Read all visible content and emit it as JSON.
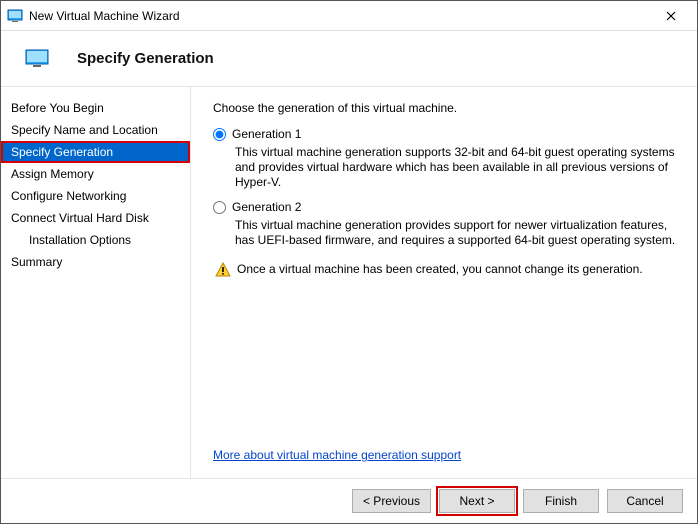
{
  "titlebar": {
    "title": "New Virtual Machine Wizard"
  },
  "header": {
    "heading": "Specify Generation"
  },
  "sidebar": {
    "items": [
      {
        "label": "Before You Begin",
        "selected": false,
        "indent": false
      },
      {
        "label": "Specify Name and Location",
        "selected": false,
        "indent": false
      },
      {
        "label": "Specify Generation",
        "selected": true,
        "indent": false
      },
      {
        "label": "Assign Memory",
        "selected": false,
        "indent": false
      },
      {
        "label": "Configure Networking",
        "selected": false,
        "indent": false
      },
      {
        "label": "Connect Virtual Hard Disk",
        "selected": false,
        "indent": false
      },
      {
        "label": "Installation Options",
        "selected": false,
        "indent": true
      },
      {
        "label": "Summary",
        "selected": false,
        "indent": false
      }
    ]
  },
  "content": {
    "intro": "Choose the generation of this virtual machine.",
    "options": [
      {
        "label": "Generation 1",
        "checked": true,
        "desc": "This virtual machine generation supports 32-bit and 64-bit guest operating systems and provides virtual hardware which has been available in all previous versions of Hyper-V."
      },
      {
        "label": "Generation 2",
        "checked": false,
        "desc": "This virtual machine generation provides support for newer virtualization features, has UEFI-based firmware, and requires a supported 64-bit guest operating system."
      }
    ],
    "warning": "Once a virtual machine has been created, you cannot change its generation.",
    "link": "More about virtual machine generation support"
  },
  "footer": {
    "previous": "< Previous",
    "next": "Next >",
    "finish": "Finish",
    "cancel": "Cancel"
  }
}
